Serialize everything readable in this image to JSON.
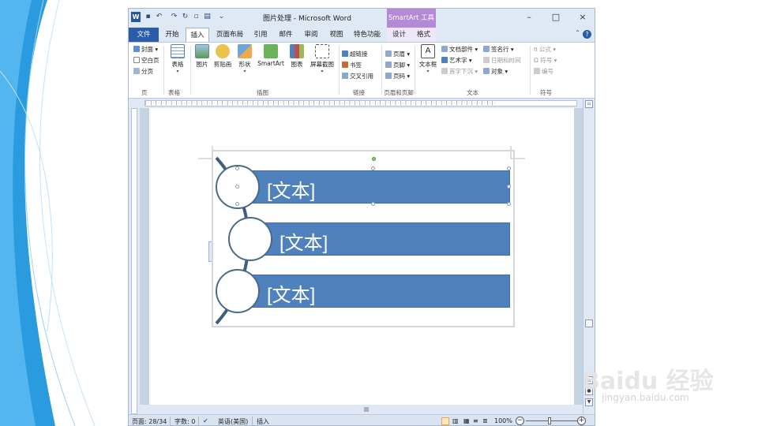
{
  "window": {
    "title": "图片处理 - Microsoft Word",
    "contextual_group": "SmartArt 工具",
    "controls": [
      "–",
      "□",
      "×"
    ]
  },
  "tabs": {
    "file": "文件",
    "items": [
      "开始",
      "插入",
      "页面布局",
      "引用",
      "邮件",
      "审阅",
      "视图",
      "特色功能",
      "设计",
      "格式"
    ],
    "active": "插入"
  },
  "ribbon": {
    "pages": {
      "items": [
        "封面",
        "空白页",
        "分页"
      ],
      "label": "页"
    },
    "tables": {
      "button": "表格",
      "label": "表格"
    },
    "illustrations": {
      "buttons": [
        "图片",
        "剪贴画",
        "形状",
        "SmartArt",
        "图表",
        "屏幕截图"
      ],
      "label": "插图"
    },
    "links": {
      "items": [
        "超链接",
        "书签",
        "交叉引用"
      ],
      "label": "链接"
    },
    "header_footer": {
      "items": [
        "页眉",
        "页脚",
        "页码"
      ],
      "label": "页眉和页脚"
    },
    "text": {
      "textbox": "文本框",
      "items_col1": [
        "文档部件",
        "艺术字",
        "首字下沉"
      ],
      "items_col2": [
        "签名行",
        "日期和时间",
        "对象"
      ],
      "label": "文本"
    },
    "symbols": {
      "items": [
        "公式",
        "符号",
        "编号"
      ],
      "label": "符号"
    }
  },
  "smartart": {
    "items": [
      "[文本]",
      "[文本]",
      "[文本]"
    ],
    "bar_color": "#4f81bd",
    "circle_border": "#4a6a8c"
  },
  "status": {
    "page": "页面: 28/34",
    "words": "字数: 0",
    "language": "英语(美国)",
    "mode": "插入",
    "zoom": "100%",
    "zoom_level": 1.0
  },
  "watermark": {
    "brand": "Baidu 经验",
    "url": "jingyan.baidu.com"
  },
  "colors": {
    "accent": "#2a5caa",
    "smartart_tab": "#b38ad6",
    "slide_deco": "#2b9be0"
  }
}
